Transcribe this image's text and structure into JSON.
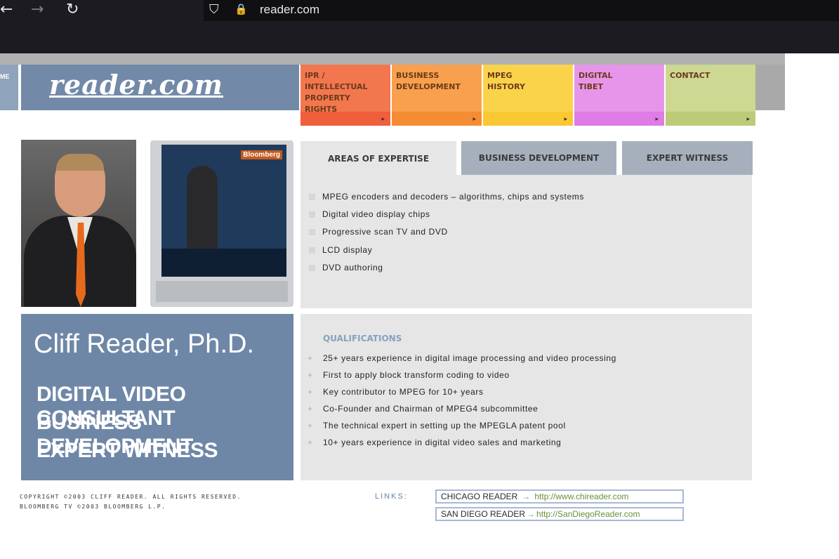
{
  "browser": {
    "back_icon": "←",
    "forward_icon": "→",
    "reload_icon": "↻",
    "shield_icon": "⛉",
    "lock_icon": "🔒",
    "url": "reader.com"
  },
  "header": {
    "left_tab_label": "ME",
    "logo": "reader.com",
    "nav": [
      {
        "label": "IPR / INTELLECTUAL PROPERTY RIGHTS",
        "color": "#f2774e",
        "foot": "#f15e3c"
      },
      {
        "label": "BUSINESS DEVELOPMENT",
        "color": "#f9a04e",
        "foot": "#f58c34"
      },
      {
        "label": "MPEG HISTORY",
        "color": "#fbd34b",
        "foot": "#f9c832"
      },
      {
        "label": "DIGITAL TIBET",
        "color": "#e795ea",
        "foot": "#df7be4"
      },
      {
        "label": "CONTACT",
        "color": "#cdd892",
        "foot": "#bccb77"
      }
    ],
    "nav_arrow": "▸"
  },
  "tabs": [
    {
      "label": "AREAS OF EXPERTISE",
      "active": true
    },
    {
      "label": "BUSINESS DEVELOPMENT",
      "active": false
    },
    {
      "label": "EXPERT WITNESS",
      "active": false
    }
  ],
  "expertise": [
    "MPEG encoders and decoders – algorithms, chips and systems",
    "Digital video display chips",
    "Progressive scan TV and DVD",
    "LCD display",
    "DVD authoring"
  ],
  "tv": {
    "channel": "Bloomberg"
  },
  "profile": {
    "name": "Cliff Reader, Ph.D.",
    "roles": [
      "DIGITAL VIDEO CONSULTANT",
      "BUSINESS DEVELOPMENT",
      "EXPERT WITNESS"
    ]
  },
  "qualifications": {
    "heading": "QUALIFICATIONS",
    "bullet": "+",
    "items": [
      "25+ years experience in digital image processing and video processing",
      "First to apply block transform coding to video",
      "Key contributor to MPEG for 10+ years",
      "Co-Founder and Chairman of MPEG4 subcommittee",
      "The technical expert in setting up the MPEGLA patent pool",
      "10+ years experience in digital video sales and marketing"
    ]
  },
  "footer": {
    "copyright_lines": [
      "COPYRIGHT ©2003 CLIFF READER. ALL RIGHTS RESERVED.",
      "BLOOMBERG TV ©2003 BLOOMBERG L.P."
    ],
    "links_label": "LINKS:",
    "link_arrow": "→",
    "links": [
      {
        "name": "CHICAGO READER",
        "url": "http://www.chireader.com"
      },
      {
        "name": "SAN DIEGO READER",
        "url": "http://SanDiegoReader.com"
      }
    ]
  },
  "colors": {
    "accent_blue": "#6f87a7",
    "panel_gray": "#e6e6e6"
  }
}
